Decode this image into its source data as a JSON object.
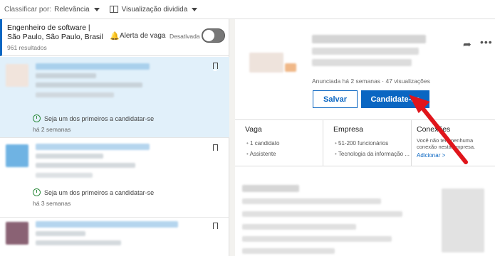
{
  "topbar": {
    "sort_label": "Classificar por:",
    "sort_value": "Relevância",
    "view_value": "Visualização dividida"
  },
  "search": {
    "title": "Engenheiro de software | São Paulo, São Paulo, Brasil",
    "results": "961 resultados",
    "alert_label": "Alerta de vaga",
    "alert_status": "Desativada"
  },
  "jobs": [
    {
      "note": "Seja um dos primeiros a candidatar-se",
      "posted": "há 2 semanas"
    },
    {
      "note": "Seja um dos primeiros a candidatar-se",
      "posted": "há 3 semanas"
    }
  ],
  "detail": {
    "posted_info": "Anunciada há 2 semanas · 47 visualizações",
    "save_label": "Salvar",
    "apply_label": "Candidate-se",
    "vaga": {
      "title": "Vaga",
      "items": [
        "1 candidato",
        "Assistente"
      ]
    },
    "empresa": {
      "title": "Empresa",
      "items": [
        "51-200 funcionários",
        "Tecnologia da informação ..."
      ]
    },
    "conexoes": {
      "title": "Conexões",
      "text": "Você não tem nenhuma conexão nesta empresa.",
      "link": "Adicionar >"
    }
  },
  "colors": {
    "primary": "#0a66c2",
    "selected_card": "#e1f0fa",
    "green": "#2e8b3e",
    "arrow": "#e0151b"
  }
}
